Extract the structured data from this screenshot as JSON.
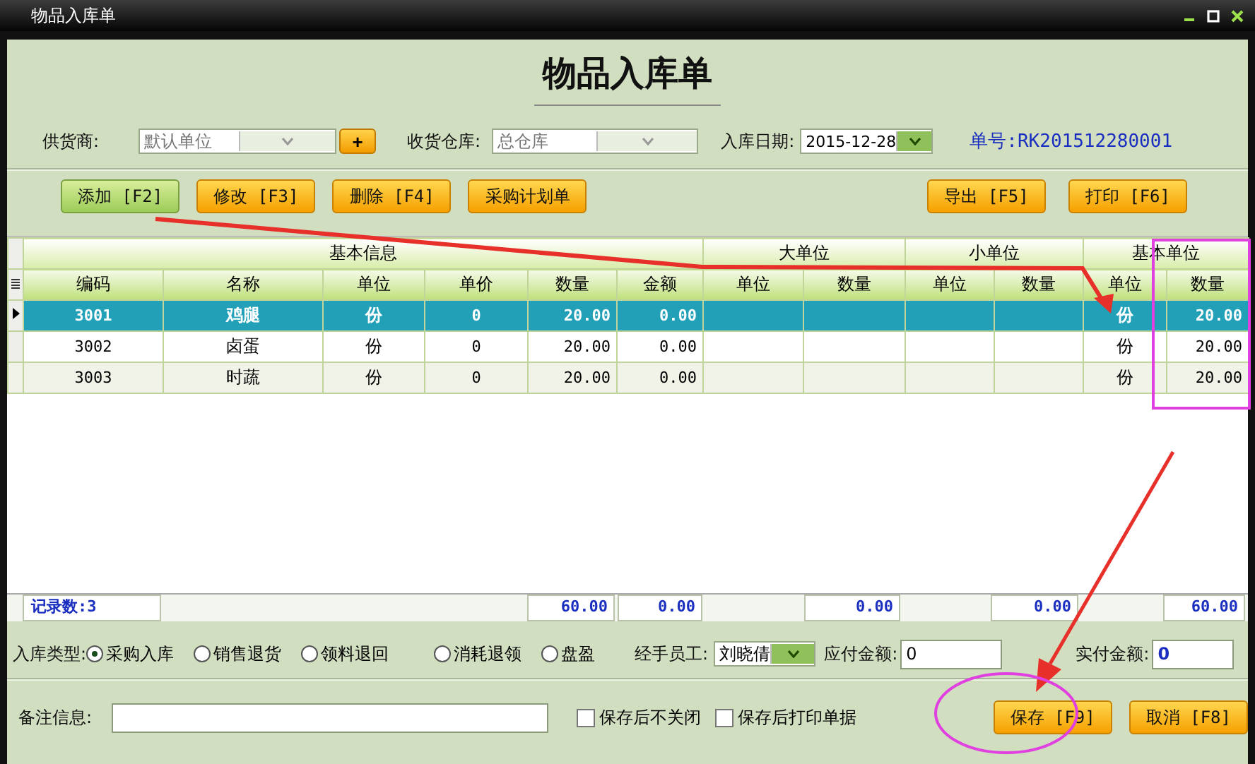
{
  "window": {
    "title": "物品入库单"
  },
  "heading": "物品入库单",
  "header_fields": {
    "supplier": {
      "label": "供货商:",
      "value": "默认单位",
      "add_button": "+"
    },
    "warehouse": {
      "label": "收货仓库:",
      "value": "总仓库"
    },
    "date": {
      "label": "入库日期:",
      "value": "2015-12-28"
    },
    "order_no": "单号:RK201512280001"
  },
  "toolbar_left": [
    {
      "label": "添加 [F2]",
      "highlighted": true
    },
    {
      "label": "修改 [F3]",
      "highlighted": false
    },
    {
      "label": "删除 [F4]",
      "highlighted": false
    },
    {
      "label": "采购计划单",
      "highlighted": false
    }
  ],
  "toolbar_right": [
    {
      "label": "导出 [F5]",
      "highlighted": false
    },
    {
      "label": "打印 [F6]",
      "highlighted": false
    }
  ],
  "table": {
    "column_groups": [
      {
        "label": "基本信息",
        "columns": [
          "编码",
          "名称",
          "单位",
          "单价",
          "数量",
          "金额"
        ]
      },
      {
        "label": "大单位",
        "columns": [
          "单位",
          "数量"
        ]
      },
      {
        "label": "小单位",
        "columns": [
          "单位",
          "数量"
        ]
      },
      {
        "label": "基本单位",
        "columns": [
          "单位",
          "数量"
        ]
      }
    ],
    "rows": [
      {
        "selected": true,
        "code": "3001",
        "name": "鸡腿",
        "unit": "份",
        "price": "0",
        "quantity": "20.00",
        "amount": "0.00",
        "base_unit": "份",
        "base_quantity": "20.00"
      },
      {
        "selected": false,
        "code": "3002",
        "name": "卤蛋",
        "unit": "份",
        "price": "0",
        "quantity": "20.00",
        "amount": "0.00",
        "base_unit": "份",
        "base_quantity": "20.00"
      },
      {
        "selected": false,
        "code": "3003",
        "name": "时蔬",
        "unit": "份",
        "price": "0",
        "quantity": "20.00",
        "amount": "0.00",
        "base_unit": "份",
        "base_quantity": "20.00"
      }
    ],
    "summary": {
      "record_count": "记录数:3",
      "quantity_total": "60.00",
      "amount_total": "0.00",
      "large_quantity_total": "0.00",
      "small_quantity_total": "0.00",
      "base_quantity_total": "60.00"
    }
  },
  "inbound_type": {
    "label": "入库类型:",
    "options": [
      {
        "label": "采购入库",
        "selected": true
      },
      {
        "label": "销售退货",
        "selected": false
      },
      {
        "label": "领料退回",
        "selected": false
      },
      {
        "label": "消耗退领",
        "selected": false
      },
      {
        "label": "盘盈",
        "selected": false
      }
    ]
  },
  "handler": {
    "label": "经手员工:",
    "value": "刘晓倩"
  },
  "payable": {
    "label": "应付金额:",
    "value": "0"
  },
  "paid": {
    "label": "实付金额:",
    "value": "0"
  },
  "remarks": {
    "label": "备注信息:"
  },
  "options": [
    {
      "label": "保存后不关闭",
      "checked": false
    },
    {
      "label": "保存后打印单据",
      "checked": false
    }
  ],
  "actions": [
    {
      "label": "保存 [F9]",
      "highlighted": false
    },
    {
      "label": "取消 [F8]",
      "highlighted": false
    }
  ]
}
